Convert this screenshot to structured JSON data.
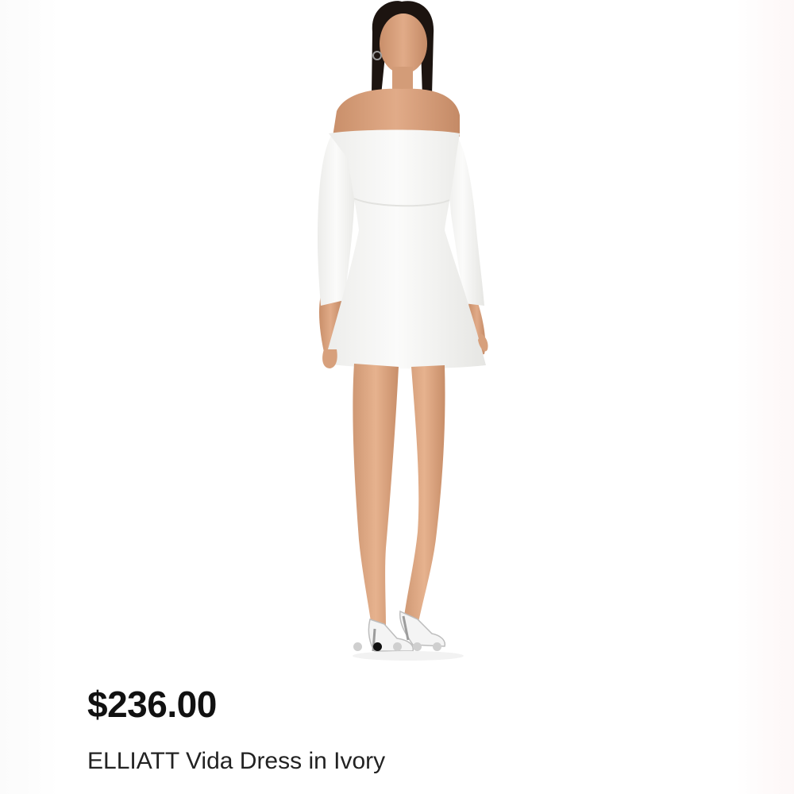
{
  "listing": {
    "price": "$236.00",
    "title": "ELLIATT Vida Dress in Ivory"
  },
  "gallery": {
    "image_count": 5,
    "active_index": 1,
    "dot_active_color": "#111111",
    "dot_inactive_color": "#cfcfcf"
  },
  "photo": {
    "subject": "model wearing white off-shoulder long-sleeve mini dress with white heels",
    "dress_color": "#f7f7f5",
    "skin_color": "#d9a27e",
    "hair_color": "#1c1410"
  }
}
